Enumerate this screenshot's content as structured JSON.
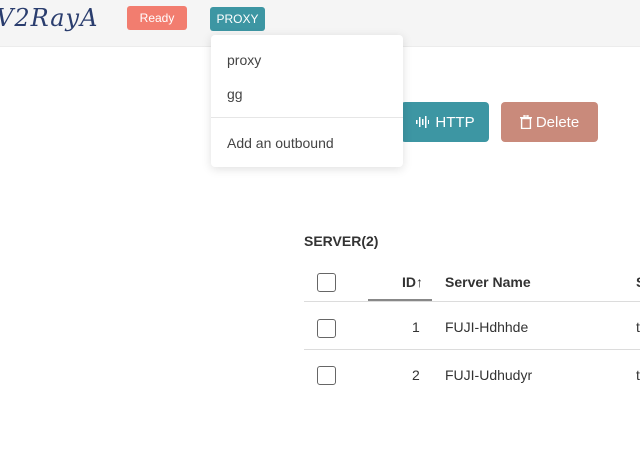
{
  "header": {
    "logo_text": "V2RayA",
    "status_badge": "Ready",
    "outbound_button": "PROXY"
  },
  "outbound_menu": {
    "items": [
      "proxy",
      "gg"
    ],
    "add_label": "Add an outbound"
  },
  "actions": {
    "http_label": "HTTP",
    "delete_label": "Delete"
  },
  "server_table": {
    "title": "SERVER(2)",
    "columns": [
      "ID",
      "Server Name",
      "S"
    ],
    "rows": [
      {
        "id": "1",
        "name": "FUJI-Hdhhde",
        "extra": "t"
      },
      {
        "id": "2",
        "name": "FUJI-Udhudyr",
        "extra": "t"
      }
    ]
  },
  "colors": {
    "primary": "#3d96a3",
    "ready": "#f27d6f",
    "delete": "#c98a7b"
  }
}
